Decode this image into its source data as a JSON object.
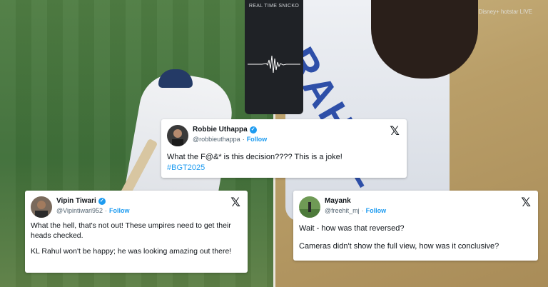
{
  "broadcast": {
    "snicko_label": "REAL TIME SNICKO",
    "logo": "Disney+ hotstar LIVE"
  },
  "player": {
    "jersey_name": "RAHUL",
    "jersey_number": "7"
  },
  "tweets": [
    {
      "name": "Robbie Uthappa",
      "handle": "@robbieuthappa",
      "follow": "Follow",
      "text": "What the F@&* is this decision???? This is a joke!",
      "hashtag": "#BGT2025"
    },
    {
      "name": "Vipin Tiwari",
      "handle": "@Vipintiwari952",
      "follow": "Follow",
      "text1": "What the hell, that's not out! These umpires need to get their heads checked.",
      "text2": "KL Rahul won't be happy; he was looking amazing out there!"
    },
    {
      "name": "Mayank",
      "handle": "@freehit_mj",
      "follow": "Follow",
      "text1": "Wait - how was that reversed?",
      "text2": "Cameras didn't show the full view, how was it conclusive?"
    }
  ],
  "colors": {
    "link": "#1d9bf0",
    "verified": "#1d9bf0",
    "jersey_text": "#2e4fa8"
  }
}
